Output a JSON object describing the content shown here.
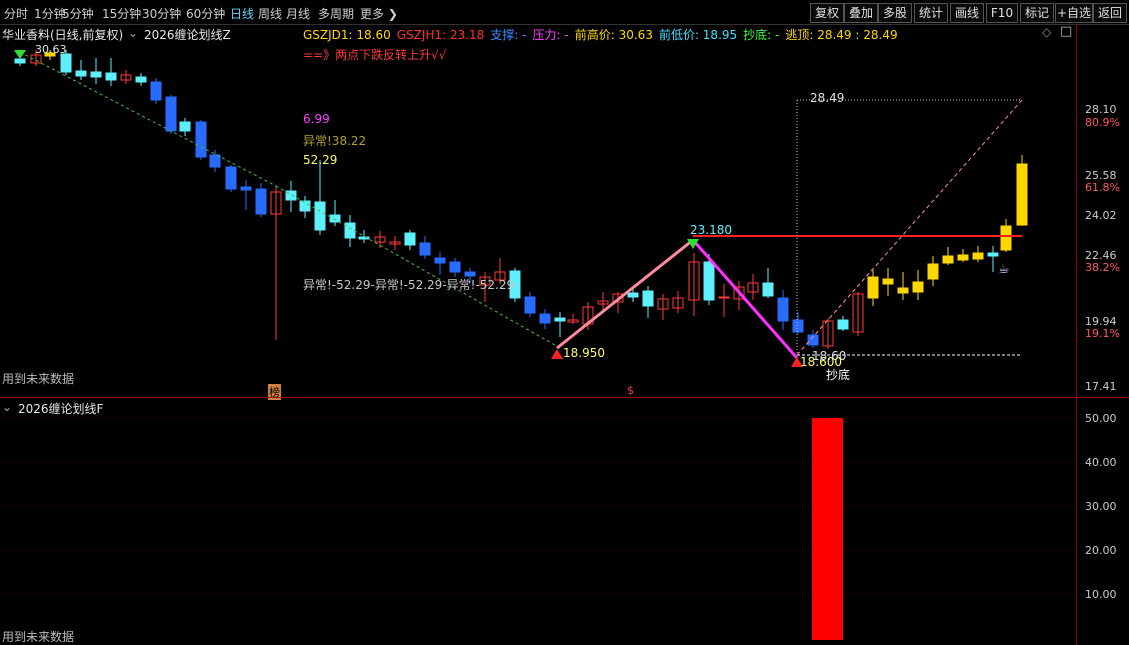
{
  "toolbar": {
    "periods": [
      "分时",
      "1分钟",
      "5分钟",
      "15分钟",
      "30分钟",
      "60分钟",
      "日线",
      "周线",
      "月线",
      "多周期",
      "更多 ❯"
    ],
    "active_period": "日线",
    "right_buttons": [
      "复权",
      "叠加",
      "多股",
      "统计",
      "画线",
      "F10",
      "标记",
      "+自选",
      "返回"
    ]
  },
  "main": {
    "stock_name": "华业香料(日线,前复权)",
    "indicator_name": "2026缠论划线Z",
    "legend": [
      {
        "label": "GSZJD1: 18.60",
        "color": "#ffd700"
      },
      {
        "label": "GSZJH1: 23.18",
        "color": "#ff3030"
      },
      {
        "label": "支撑: -",
        "color": "#3b8fff"
      },
      {
        "label": "压力: -",
        "color": "#ff40ff"
      },
      {
        "label": "前高价: 30.63",
        "color": "#ffd700"
      },
      {
        "label": "前低价: 18.95",
        "color": "#40e0ff"
      },
      {
        "label": "抄底: -",
        "color": "#40ff40"
      },
      {
        "label": "逃顶: 28.49 : 28.49",
        "color": "#ffd700"
      }
    ],
    "signal_text": "==》两点下跌反转上升√√",
    "top_label": "30.63",
    "annot_1": "6.99",
    "annot_2": "异常!38.22",
    "annot_3": "52.29",
    "abnormal_text": "异常!-52.29-异常!-52.29-异常!-52.29-",
    "low_label_1": "18.950",
    "peak_label": "23.180",
    "low_label_2": "18.600",
    "level_label_1": "28.49",
    "level_label_2": "18.60",
    "chaodi": "抄底",
    "future_data": "用到未来数据",
    "marker_bang": "榜",
    "marker_s": "$",
    "colors": {
      "up": "#ff3a3a",
      "down": "#2a6bff",
      "cyan": "#5ff0ff",
      "gold": "#ffd700",
      "pink": "#ff8aa0",
      "magenta": "#ff30ff"
    }
  },
  "yaxis_main": [
    {
      "label": "28.10",
      "pct": false
    },
    {
      "label": "80.9%",
      "pct": true
    },
    {
      "label": "25.58",
      "pct": false
    },
    {
      "label": "61.8%",
      "pct": true
    },
    {
      "label": "24.02",
      "pct": false
    },
    {
      "label": "22.46",
      "pct": false
    },
    {
      "label": "38.2%",
      "pct": true
    },
    {
      "label": "19.94",
      "pct": false
    },
    {
      "label": "19.1%",
      "pct": true
    },
    {
      "label": "17.41",
      "pct": false
    }
  ],
  "sub": {
    "indicator_name": "2026缠论划线F",
    "future_data": "用到未来数据",
    "yaxis": [
      "50.00",
      "40.00",
      "30.00",
      "20.00",
      "10.00"
    ],
    "bar_value": 50
  }
}
